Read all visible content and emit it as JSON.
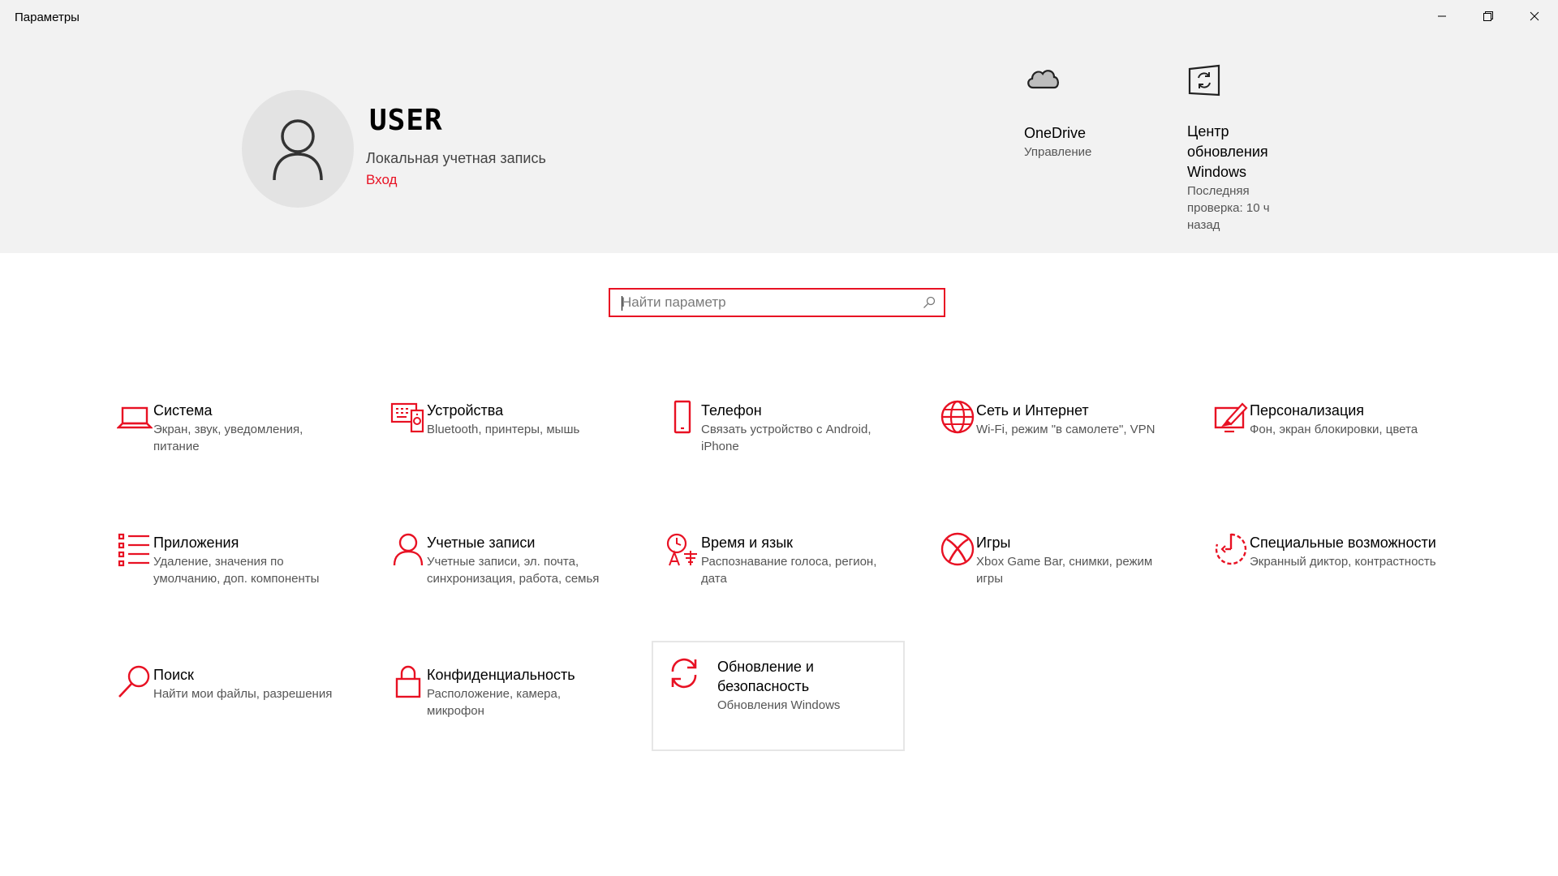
{
  "window": {
    "title": "Параметры"
  },
  "account": {
    "username": "USER",
    "type": "Локальная учетная запись",
    "signin": "Вход"
  },
  "quick_links": [
    {
      "title": "OneDrive",
      "subtitle": "Управление",
      "icon": "cloud-icon"
    },
    {
      "title": "Центр обновления Windows",
      "subtitle": "Последняя проверка: 10 ч назад",
      "icon": "windows-update-icon"
    }
  ],
  "search": {
    "placeholder": "Найти параметр",
    "value": ""
  },
  "accent_color": "#e81123",
  "categories": [
    {
      "title": "Система",
      "desc": "Экран, звук, уведомления, питание",
      "icon": "laptop-icon"
    },
    {
      "title": "Устройства",
      "desc": "Bluetooth, принтеры, мышь",
      "icon": "devices-icon"
    },
    {
      "title": "Телефон",
      "desc": "Связать устройство с Android, iPhone",
      "icon": "phone-icon"
    },
    {
      "title": "Сеть и Интернет",
      "desc": "Wi-Fi, режим \"в самолете\", VPN",
      "icon": "globe-icon"
    },
    {
      "title": "Персонализация",
      "desc": "Фон, экран блокировки, цвета",
      "icon": "paint-icon"
    },
    {
      "title": "Приложения",
      "desc": "Удаление, значения по умолчанию, доп. компоненты",
      "icon": "apps-list-icon"
    },
    {
      "title": "Учетные записи",
      "desc": "Учетные записи, эл. почта, синхронизация, работа, семья",
      "icon": "person-icon"
    },
    {
      "title": "Время и язык",
      "desc": "Распознавание голоса, регион, дата",
      "icon": "time-language-icon"
    },
    {
      "title": "Игры",
      "desc": "Xbox Game Bar, снимки, режим игры",
      "icon": "xbox-icon"
    },
    {
      "title": "Специальные возможности",
      "desc": "Экранный диктор, контрастность",
      "icon": "accessibility-icon"
    },
    {
      "title": "Поиск",
      "desc": "Найти мои файлы, разрешения",
      "icon": "search-icon"
    },
    {
      "title": "Конфиденциальность",
      "desc": "Расположение, камера, микрофон",
      "icon": "lock-icon"
    },
    {
      "title": "Обновление и безопасность",
      "desc": "Обновления Windows",
      "icon": "sync-icon"
    }
  ]
}
